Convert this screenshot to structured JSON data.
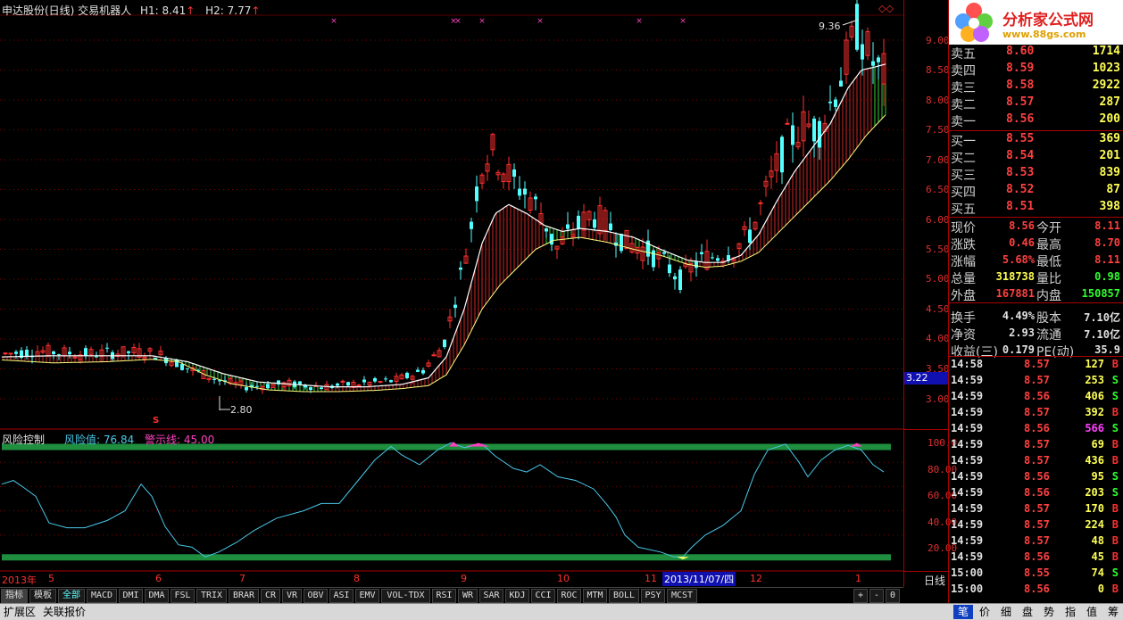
{
  "header": {
    "title": "申达股份(日线) 交易机器人",
    "h1": "H1: 8.41",
    "h2": "H2: 7.77",
    "arrow": "↑"
  },
  "annotations": {
    "high": "9.36",
    "low": "2.80",
    "marker": "S",
    "cursor_price": "3.22",
    "cursor_date": "2013/11/07/四"
  },
  "indicator": {
    "name": "风险控制",
    "risk_label": "风险值: 76.84",
    "warn_label": "警示线: 45.00"
  },
  "price_axis": [
    "9.00",
    "8.50",
    "8.00",
    "7.50",
    "7.00",
    "6.50",
    "6.00",
    "5.50",
    "5.00",
    "4.50",
    "4.00",
    "3.50",
    "3.00"
  ],
  "ind_axis": [
    "100.0",
    "80.00",
    "60.00",
    "40.00",
    "20.00"
  ],
  "x_axis": {
    "year": "2013年",
    "months": [
      "5",
      "6",
      "7",
      "8",
      "9",
      "10",
      "11",
      "12",
      "1"
    ],
    "period": "日线"
  },
  "order_book": {
    "sells": [
      {
        "label": "卖五",
        "price": "8.60",
        "vol": "1714"
      },
      {
        "label": "卖四",
        "price": "8.59",
        "vol": "1023"
      },
      {
        "label": "卖三",
        "price": "8.58",
        "vol": "2922"
      },
      {
        "label": "卖二",
        "price": "8.57",
        "vol": "287"
      },
      {
        "label": "卖一",
        "price": "8.56",
        "vol": "200"
      }
    ],
    "buys": [
      {
        "label": "买一",
        "price": "8.55",
        "vol": "369"
      },
      {
        "label": "买二",
        "price": "8.54",
        "vol": "201"
      },
      {
        "label": "买三",
        "price": "8.53",
        "vol": "839"
      },
      {
        "label": "买四",
        "price": "8.52",
        "vol": "87"
      },
      {
        "label": "买五",
        "price": "8.51",
        "vol": "398"
      }
    ]
  },
  "stats": [
    {
      "l1": "现价",
      "v1": "8.56",
      "l2": "今开",
      "v2": "8.11",
      "c1": "#ff4040",
      "c2": "#ff4040"
    },
    {
      "l1": "涨跌",
      "v1": "0.46",
      "l2": "最高",
      "v2": "8.70",
      "c1": "#ff4040",
      "c2": "#ff4040"
    },
    {
      "l1": "涨幅",
      "v1": "5.68%",
      "l2": "最低",
      "v2": "8.11",
      "c1": "#ff4040",
      "c2": "#ff4040"
    },
    {
      "l1": "总量",
      "v1": "318738",
      "l2": "量比",
      "v2": "0.98",
      "c1": "#ffff55",
      "c2": "#30ff30"
    },
    {
      "l1": "外盘",
      "v1": "167881",
      "l2": "内盘",
      "v2": "150857",
      "c1": "#ff4040",
      "c2": "#30ff30"
    },
    {
      "l1": "换手",
      "v1": "4.49%",
      "l2": "股本",
      "v2": "7.10亿",
      "c1": "#e0e0e0",
      "c2": "#e0e0e0"
    },
    {
      "l1": "净资",
      "v1": "2.93",
      "l2": "流通",
      "v2": "7.10亿",
      "c1": "#e0e0e0",
      "c2": "#e0e0e0"
    },
    {
      "l1": "收益(三)",
      "v1": "0.179",
      "l2": "PE(动)",
      "v2": "35.9",
      "c1": "#e0e0e0",
      "c2": "#e0e0e0"
    }
  ],
  "ticks": [
    {
      "t": "14:58",
      "p": "8.57",
      "v": "127",
      "s": "B"
    },
    {
      "t": "14:59",
      "p": "8.57",
      "v": "253",
      "s": "S"
    },
    {
      "t": "14:59",
      "p": "8.56",
      "v": "406",
      "s": "S"
    },
    {
      "t": "14:59",
      "p": "8.57",
      "v": "392",
      "s": "B"
    },
    {
      "t": "14:59",
      "p": "8.56",
      "v": "566",
      "s": "S"
    },
    {
      "t": "14:59",
      "p": "8.57",
      "v": "69",
      "s": "B"
    },
    {
      "t": "14:59",
      "p": "8.57",
      "v": "436",
      "s": "B"
    },
    {
      "t": "14:59",
      "p": "8.56",
      "v": "95",
      "s": "S"
    },
    {
      "t": "14:59",
      "p": "8.56",
      "v": "203",
      "s": "S"
    },
    {
      "t": "14:59",
      "p": "8.57",
      "v": "170",
      "s": "B"
    },
    {
      "t": "14:59",
      "p": "8.57",
      "v": "224",
      "s": "B"
    },
    {
      "t": "14:59",
      "p": "8.57",
      "v": "48",
      "s": "B"
    },
    {
      "t": "14:59",
      "p": "8.56",
      "v": "45",
      "s": "B"
    },
    {
      "t": "15:00",
      "p": "8.55",
      "v": "74",
      "s": "S"
    },
    {
      "t": "15:00",
      "p": "8.56",
      "v": "0",
      "s": "B"
    }
  ],
  "tabs": [
    "指标",
    "模板",
    "全部",
    "MACD",
    "DMI",
    "DMA",
    "FSL",
    "TRIX",
    "BRAR",
    "CR",
    "VR",
    "OBV",
    "ASI",
    "EMV",
    "VOL-TDX",
    "RSI",
    "WR",
    "SAR",
    "KDJ",
    "CCI",
    "ROC",
    "MTM",
    "BOLL",
    "PSY",
    "MCST"
  ],
  "tab_controls": [
    "+",
    "-",
    "0"
  ],
  "status_left": [
    "扩展区",
    "关联报价"
  ],
  "status_right": [
    "笔",
    "价",
    "细",
    "盘",
    "势",
    "指",
    "值",
    "筹"
  ],
  "logo": {
    "title": "分析家公式网",
    "url": "www.88gs.com"
  },
  "colors": {
    "up": "#ff3030",
    "down": "#54ffff",
    "ma": "#ffffff",
    "fill_green": "#40ff40",
    "band": "#1f8f3f",
    "risk": "#4ac8e8",
    "pink": "#ff40c0"
  },
  "chart_data": [
    {
      "type": "candlestick",
      "title": "申达股份(日线) 交易机器人",
      "ylim": [
        2.6,
        9.6
      ],
      "annotated_high": 9.36,
      "annotated_low": 2.8,
      "series": [
        {
          "name": "H1",
          "values": [
            8.41
          ]
        },
        {
          "name": "H2",
          "values": [
            7.77
          ]
        }
      ]
    },
    {
      "type": "line",
      "title": "风险控制",
      "ylim": [
        0,
        110
      ],
      "series": [
        {
          "name": "风险值",
          "last": 76.84
        },
        {
          "name": "警示线",
          "values": [
            45.0
          ]
        }
      ]
    }
  ]
}
